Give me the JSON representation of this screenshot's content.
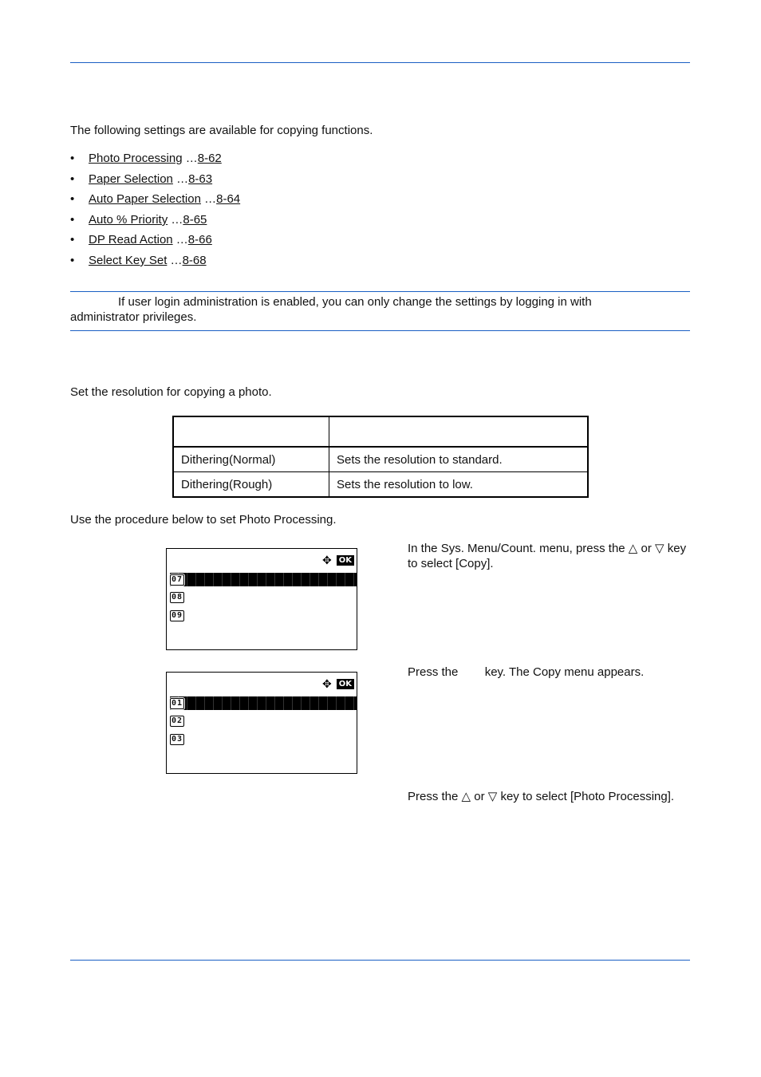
{
  "intro": "The following settings are available for copying functions.",
  "settings_links": [
    {
      "label": "Photo Processing",
      "sep": " …",
      "page": "8-62"
    },
    {
      "label": "Paper Selection",
      "sep": " …",
      "page": "8-63"
    },
    {
      "label": "Auto Paper Selection",
      "sep": " …",
      "page": "8-64"
    },
    {
      "label": "Auto % Priority",
      "sep": " …",
      "page": "8-65"
    },
    {
      "label": "DP Read Action",
      "sep": " …",
      "page": "8-66"
    },
    {
      "label": "Select Key Set",
      "sep": " …",
      "page": "8-68"
    }
  ],
  "bullet_glyph": "•",
  "note": "If user login administration is enabled, you can only change the settings by logging in with administrator privileges.",
  "section_description": "Set the resolution for copying a photo.",
  "options_table": {
    "header": [
      "",
      ""
    ],
    "rows": [
      [
        "Dithering(Normal)",
        "Sets the resolution to standard."
      ],
      [
        "Dithering(Rough)",
        "Sets the resolution to low."
      ]
    ]
  },
  "procedure_intro": "Use the procedure below to set Photo Processing.",
  "screens": [
    {
      "nav_icon": "✥",
      "ok_label": "OK",
      "rows": [
        "07",
        "08",
        "09"
      ],
      "selected": 0
    },
    {
      "nav_icon": "✥",
      "ok_label": "OK",
      "rows": [
        "01",
        "02",
        "03"
      ],
      "selected": 0
    }
  ],
  "steps": [
    "In the Sys. Menu/Count. menu, press the △ or ▽ key to select [Copy].",
    "Press the        key. The Copy menu appears.",
    "Press the △ or ▽ key to select [Photo Processing]."
  ],
  "colors": {
    "rule": "#1a5fc4"
  }
}
